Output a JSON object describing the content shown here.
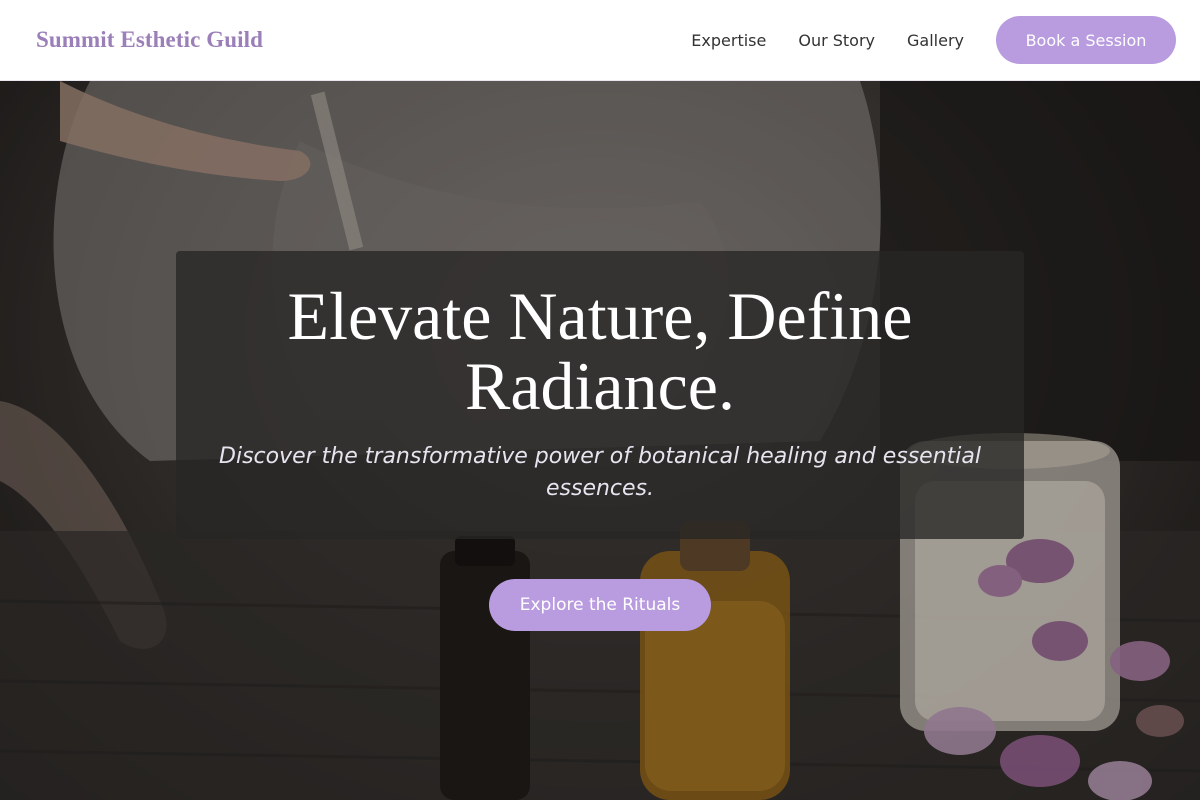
{
  "brand": {
    "name": "Summit Esthetic Guild"
  },
  "nav": {
    "links": [
      "Expertise",
      "Our Story",
      "Gallery"
    ],
    "cta_label": "Book a Session"
  },
  "hero": {
    "title": "Elevate Nature, Define Radiance.",
    "subtitle": "Discover the transformative power of botanical healing and essential essences.",
    "cta_label": "Explore the Rituals"
  },
  "colors": {
    "accent": "#b99be0",
    "brand_text": "#9b7fb8",
    "nav_text": "#333333",
    "hero_text": "#ffffff"
  }
}
